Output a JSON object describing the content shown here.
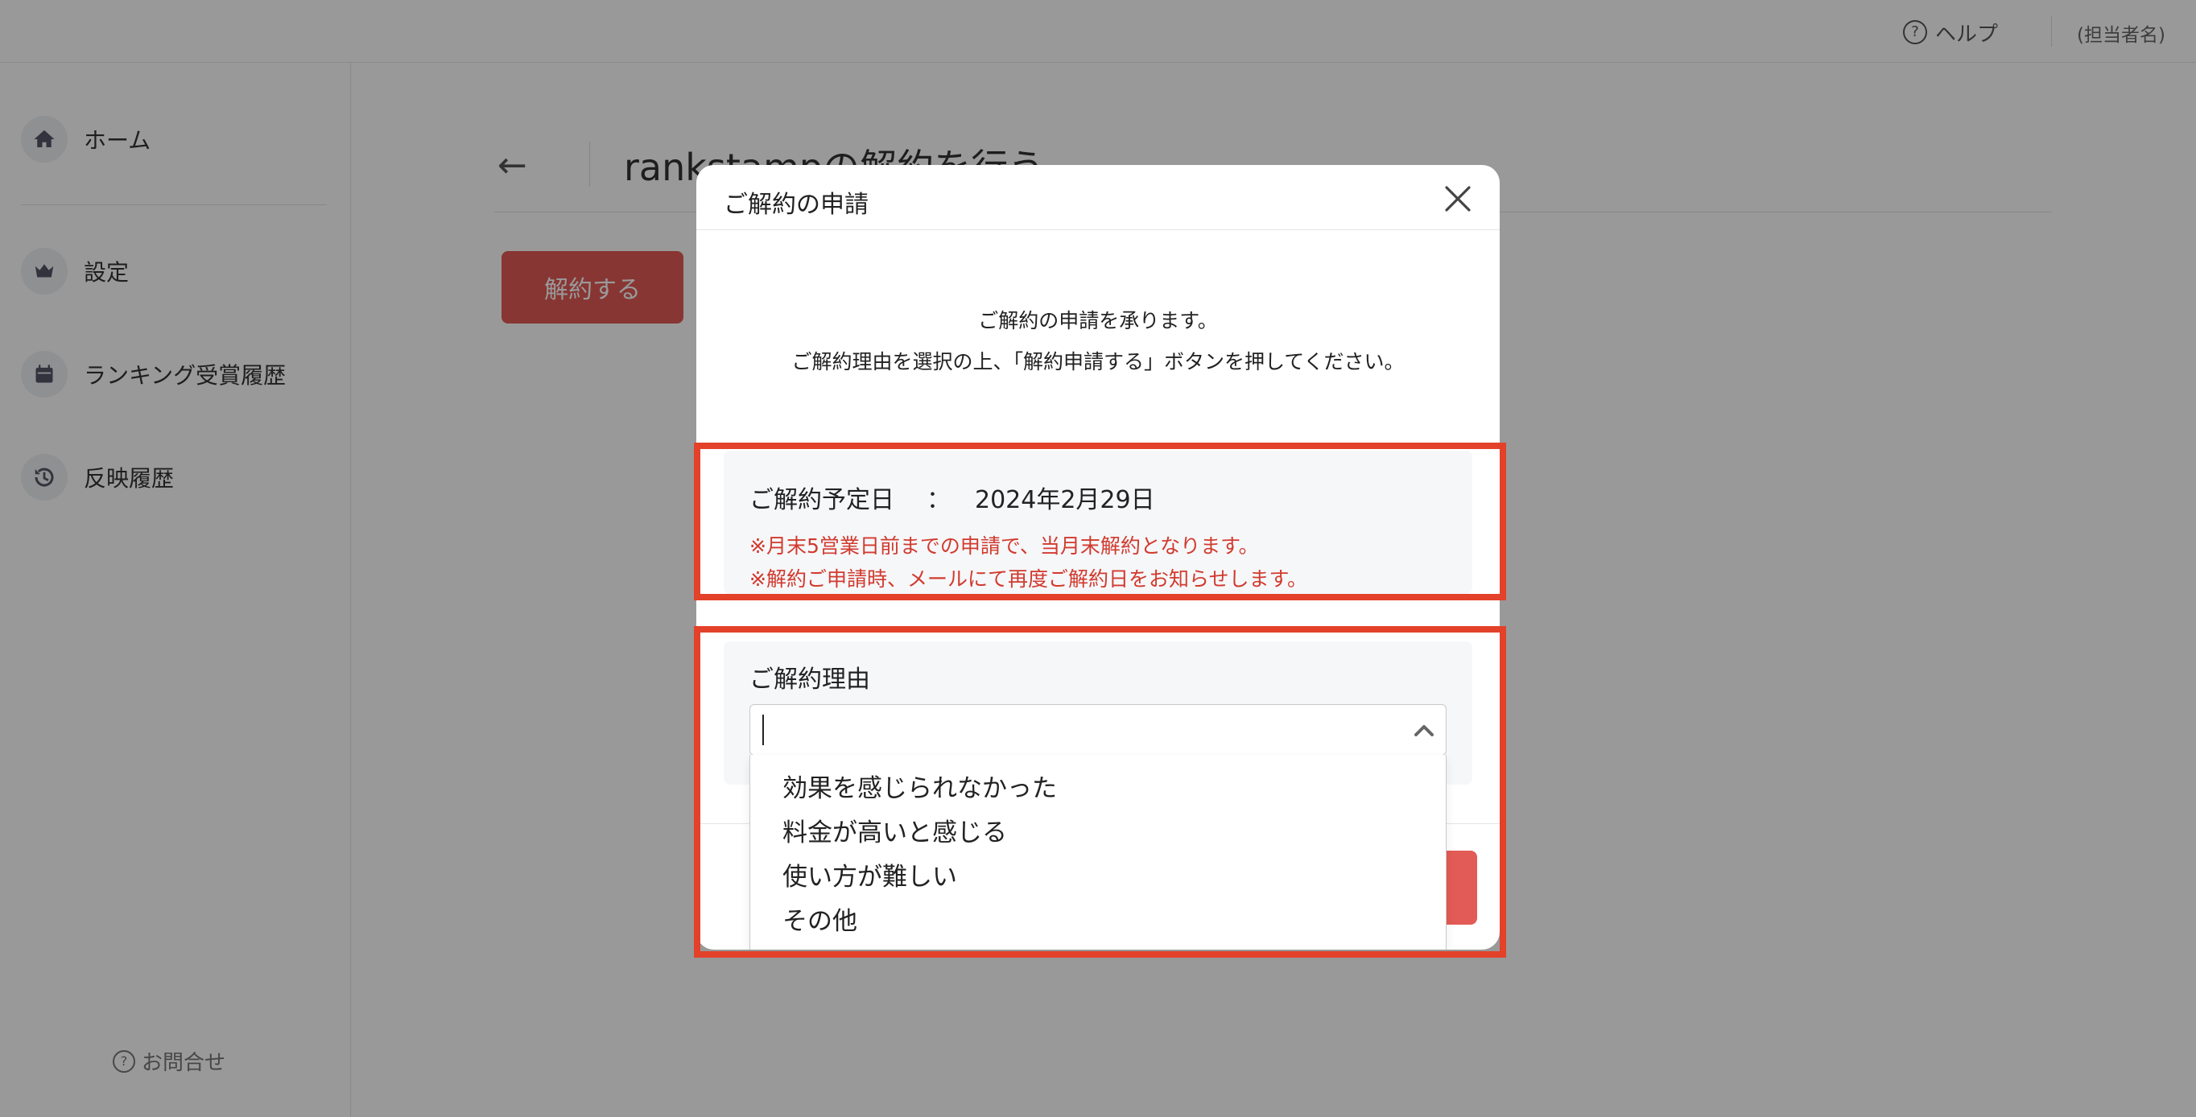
{
  "topbar": {
    "help_label": "ヘルプ",
    "user_label": "(担当者名)"
  },
  "sidebar": {
    "items": [
      {
        "label": "ホーム",
        "icon": "home-icon"
      },
      {
        "label": "設定",
        "icon": "crown-icon"
      },
      {
        "label": "ランキング受賞履歴",
        "icon": "calendar-icon"
      },
      {
        "label": "反映履歴",
        "icon": "history-icon"
      }
    ],
    "contact_label": "お問合せ"
  },
  "page": {
    "title": "rankstampの解約を行う",
    "cancel_button": "解約する"
  },
  "modal": {
    "title": "ご解約の申請",
    "intro_line1": "ご解約の申請を承ります。",
    "intro_line2": "ご解約理由を選択の上、「解約申請する」ボタンを押してください。",
    "date_label": "ご解約予定日",
    "date_separator": "：",
    "date_value": "2024年2月29日",
    "note1": "※月末5営業日前までの申請で、当月末解約となります。",
    "note2": "※解約ご申請時、メールにて再度ご解約日をお知らせします。",
    "reason_label": "ご解約理由",
    "reason_value": "",
    "reason_options": [
      "効果を感じられなかった",
      "料金が高いと感じる",
      "使い方が難しい",
      "その他"
    ]
  },
  "colors": {
    "accent_red": "#e35b56",
    "highlight_red": "#e3412a",
    "note_red": "#d23a2e"
  }
}
